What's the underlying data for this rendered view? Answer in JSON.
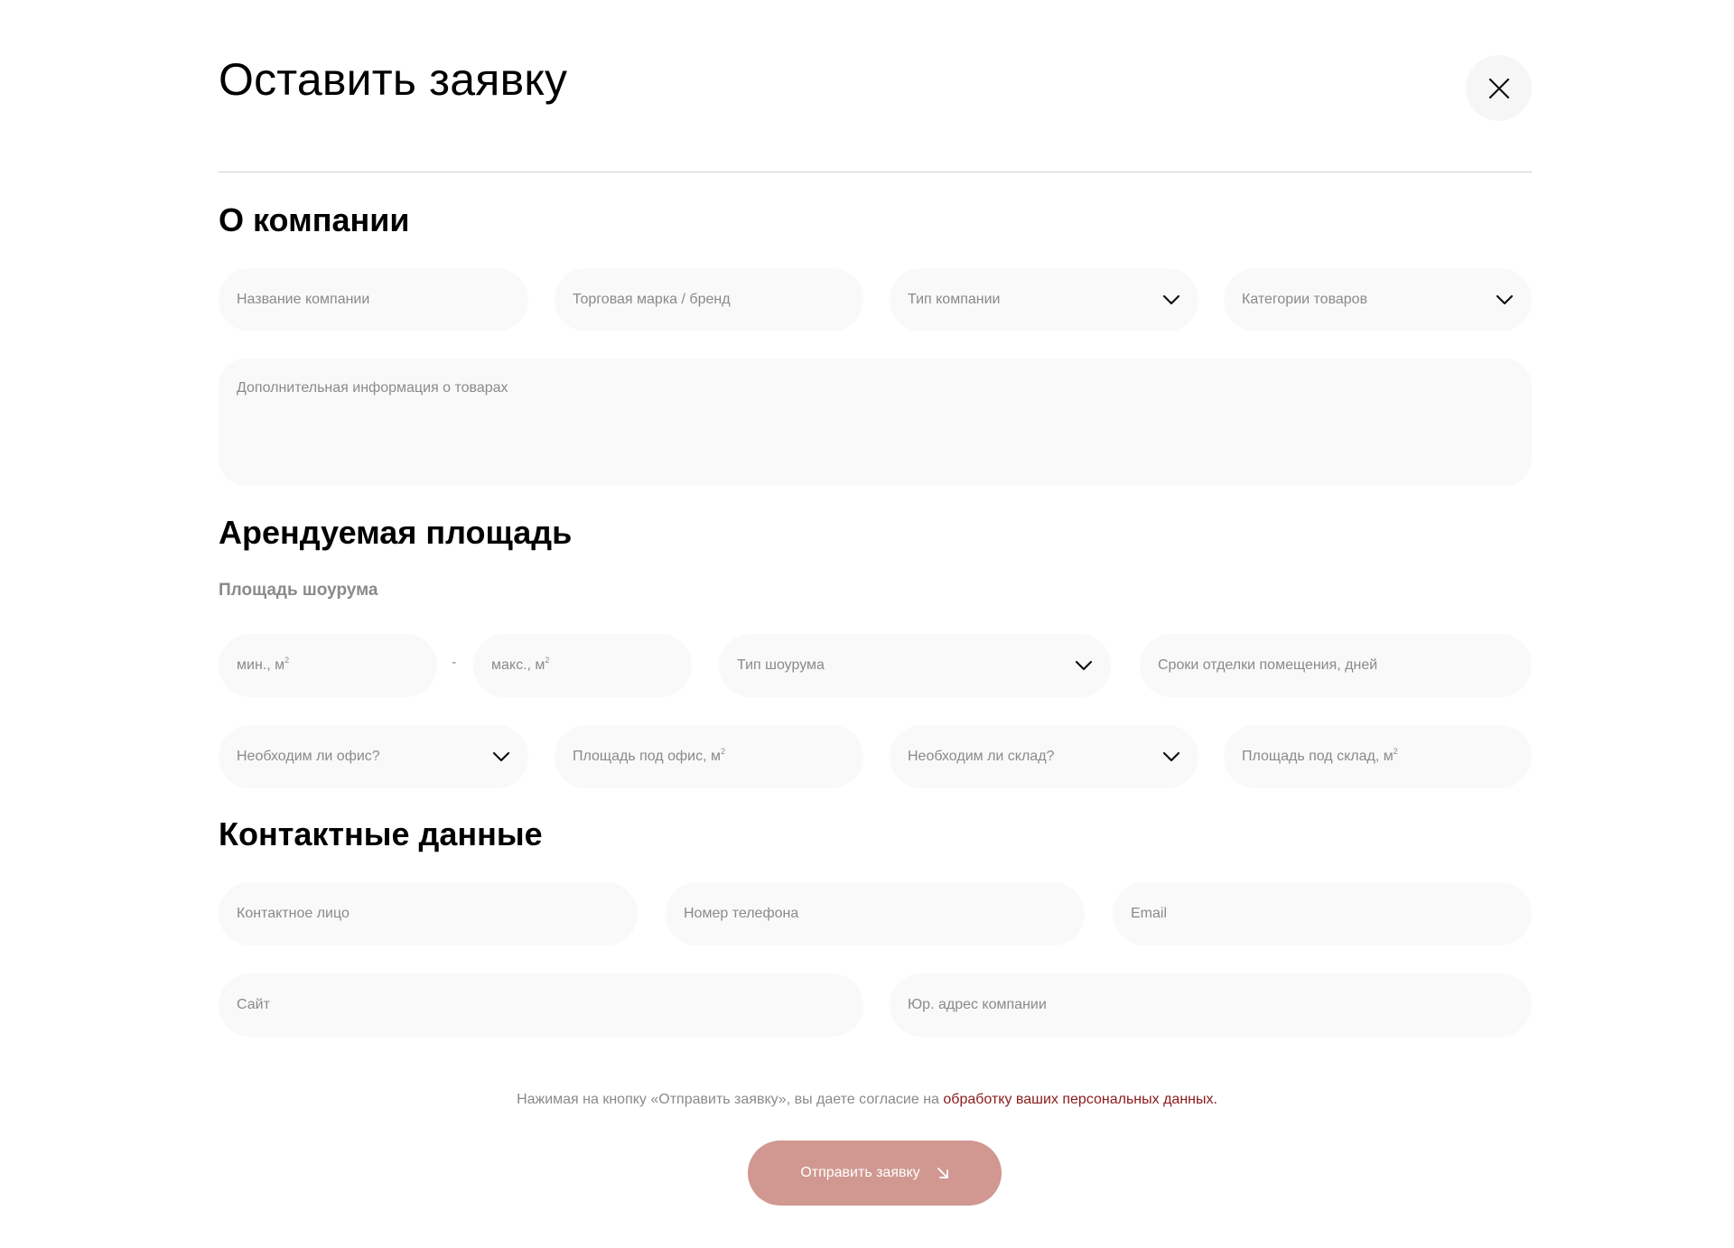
{
  "modal": {
    "title": "Оставить заявку",
    "close_icon": "close-icon"
  },
  "company": {
    "heading": "О компании",
    "name_placeholder": "Название компании",
    "brand_placeholder": "Торговая марка / бренд",
    "type_label": "Тип компании",
    "categories_label": "Категории товаров",
    "extra_info_placeholder": "Дополнительная информация о товарах"
  },
  "area": {
    "heading": "Арендуемая площадь",
    "showroom_label": "Площадь шоурума",
    "min_placeholder": "мин., м",
    "max_placeholder": "макс., м",
    "range_separator": "-",
    "showroom_type_label": "Тип шоурума",
    "finishing_days_placeholder": "Сроки отделки помещения, дней",
    "office_needed_label": "Необходим ли офис?",
    "office_area_placeholder": "Площадь под офис, м",
    "warehouse_needed_label": "Необходим ли склад?",
    "warehouse_area_placeholder": "Площадь под склад, м",
    "unit_superscript": "2"
  },
  "contacts": {
    "heading": "Контактные данные",
    "person_placeholder": "Контактное лицо",
    "phone_placeholder": "Номер телефона",
    "email_placeholder": "Email",
    "site_placeholder": "Сайт",
    "legal_address_placeholder": "Юр. адрес компании"
  },
  "consent": {
    "text": "Нажимая на кнопку «Отправить заявку», вы даете согласие на ",
    "link": "обработку ваших персональных данных."
  },
  "submit": {
    "label": "Отправить заявку",
    "icon": "arrow-down-right-icon"
  },
  "colors": {
    "accent": "#d09891",
    "link": "#8b1a1a",
    "field_bg": "#f9f9fa",
    "placeholder": "#8a8a8a"
  }
}
